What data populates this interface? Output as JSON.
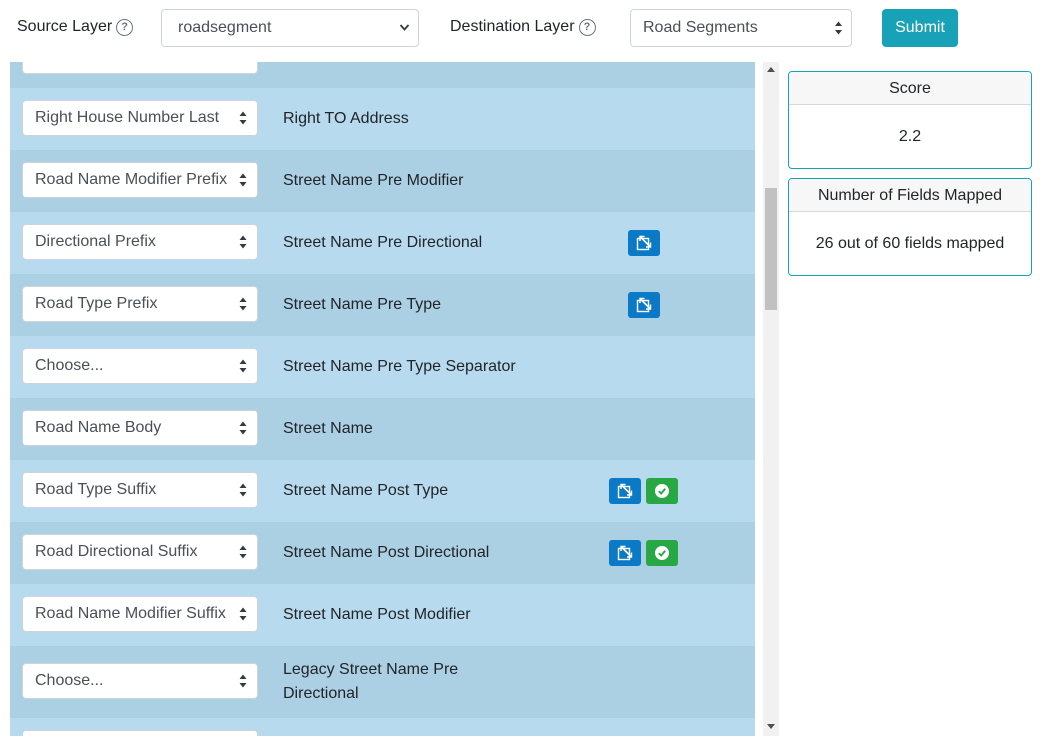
{
  "header": {
    "source_label": "Source Layer",
    "source_value": "roadsegment",
    "destination_label": "Destination Layer",
    "destination_value": "Road Segments",
    "help_glyph": "?",
    "submit_label": "Submit"
  },
  "rows": [
    {
      "source": "Right House Number Last",
      "dest": "Right TO Address"
    },
    {
      "source": "Road Name Modifier Prefix",
      "dest": "Street Name Pre Modifier"
    },
    {
      "source": "Directional Prefix",
      "dest": "Street Name Pre Directional"
    },
    {
      "source": "Road Type Prefix",
      "dest": "Street Name Pre Type"
    },
    {
      "source": "Choose...",
      "dest": "Street Name Pre Type Separator"
    },
    {
      "source": "Road Name Body",
      "dest": "Street Name"
    },
    {
      "source": "Road Type Suffix",
      "dest": "Street Name Post Type"
    },
    {
      "source": "Road Directional Suffix",
      "dest": "Street Name Post Directional"
    },
    {
      "source": "Road Name Modifier Suffix",
      "dest": "Street Name Post Modifier"
    },
    {
      "source": "Choose...",
      "dest": "Legacy Street Name Pre Directional"
    }
  ],
  "score": {
    "title": "Score",
    "value": "2.2"
  },
  "fields_mapped": {
    "title": "Number of Fields Mapped",
    "value": "26 out of 60 fields mapped"
  },
  "icons": {
    "expand": "expand-icon",
    "check": "check-circle-icon",
    "sort": "sort-arrows-icon"
  },
  "colors": {
    "row_light": "#b8daef",
    "row_dark": "#abcfe3",
    "accent": "#17a2b8",
    "icon_blue": "#0b7ac6",
    "icon_green": "#28a745"
  }
}
